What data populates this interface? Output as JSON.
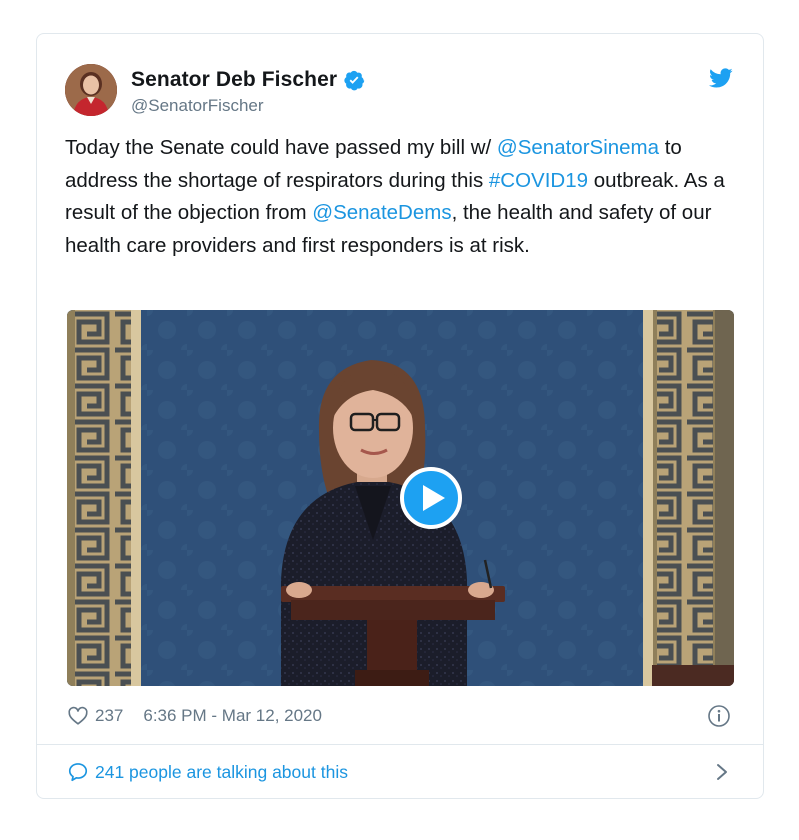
{
  "author": {
    "display_name": "Senator Deb Fischer",
    "handle": "@SenatorFischer"
  },
  "tweet": {
    "segments": [
      {
        "text": "Today the Senate could have passed my bill w/ ",
        "type": "text"
      },
      {
        "text": "@SenatorSinema",
        "type": "link"
      },
      {
        "text": " to address the shortage of respirators during this ",
        "type": "text"
      },
      {
        "text": "#COVID19",
        "type": "link"
      },
      {
        "text": " outbreak. As a result of the objection from ",
        "type": "text"
      },
      {
        "text": "@SenateDems",
        "type": "link"
      },
      {
        "text": ", the health and safety of our health care providers and first responders is at risk.",
        "type": "text"
      }
    ]
  },
  "meta": {
    "likes": "237",
    "timestamp": "6:36 PM - Mar 12, 2020"
  },
  "footer": {
    "conversation": "241 people are talking about this"
  },
  "colors": {
    "link": "#1b95e0",
    "muted": "#657786",
    "brand": "#1da1f2",
    "border": "#e1e8ed"
  },
  "icons": [
    "verified-badge-icon",
    "twitter-bird-icon",
    "play-icon",
    "heart-icon",
    "info-icon",
    "reply-bubble-icon",
    "chevron-right-icon"
  ]
}
